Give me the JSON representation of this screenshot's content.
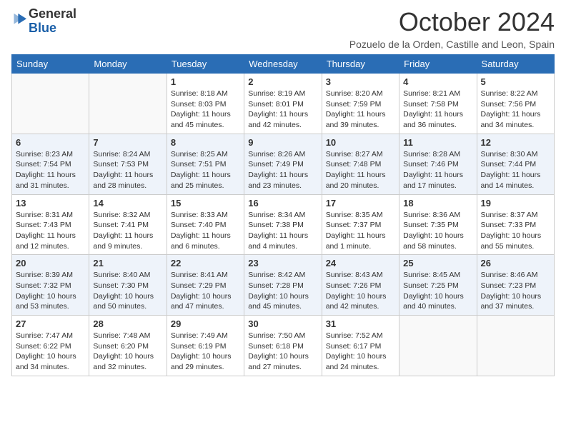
{
  "header": {
    "logo_line1": "General",
    "logo_line2": "Blue",
    "title": "October 2024",
    "location": "Pozuelo de la Orden, Castille and Leon, Spain"
  },
  "days_of_week": [
    "Sunday",
    "Monday",
    "Tuesday",
    "Wednesday",
    "Thursday",
    "Friday",
    "Saturday"
  ],
  "weeks": [
    [
      {
        "day": "",
        "info": ""
      },
      {
        "day": "",
        "info": ""
      },
      {
        "day": "1",
        "info": "Sunrise: 8:18 AM\nSunset: 8:03 PM\nDaylight: 11 hours and 45 minutes."
      },
      {
        "day": "2",
        "info": "Sunrise: 8:19 AM\nSunset: 8:01 PM\nDaylight: 11 hours and 42 minutes."
      },
      {
        "day": "3",
        "info": "Sunrise: 8:20 AM\nSunset: 7:59 PM\nDaylight: 11 hours and 39 minutes."
      },
      {
        "day": "4",
        "info": "Sunrise: 8:21 AM\nSunset: 7:58 PM\nDaylight: 11 hours and 36 minutes."
      },
      {
        "day": "5",
        "info": "Sunrise: 8:22 AM\nSunset: 7:56 PM\nDaylight: 11 hours and 34 minutes."
      }
    ],
    [
      {
        "day": "6",
        "info": "Sunrise: 8:23 AM\nSunset: 7:54 PM\nDaylight: 11 hours and 31 minutes."
      },
      {
        "day": "7",
        "info": "Sunrise: 8:24 AM\nSunset: 7:53 PM\nDaylight: 11 hours and 28 minutes."
      },
      {
        "day": "8",
        "info": "Sunrise: 8:25 AM\nSunset: 7:51 PM\nDaylight: 11 hours and 25 minutes."
      },
      {
        "day": "9",
        "info": "Sunrise: 8:26 AM\nSunset: 7:49 PM\nDaylight: 11 hours and 23 minutes."
      },
      {
        "day": "10",
        "info": "Sunrise: 8:27 AM\nSunset: 7:48 PM\nDaylight: 11 hours and 20 minutes."
      },
      {
        "day": "11",
        "info": "Sunrise: 8:28 AM\nSunset: 7:46 PM\nDaylight: 11 hours and 17 minutes."
      },
      {
        "day": "12",
        "info": "Sunrise: 8:30 AM\nSunset: 7:44 PM\nDaylight: 11 hours and 14 minutes."
      }
    ],
    [
      {
        "day": "13",
        "info": "Sunrise: 8:31 AM\nSunset: 7:43 PM\nDaylight: 11 hours and 12 minutes."
      },
      {
        "day": "14",
        "info": "Sunrise: 8:32 AM\nSunset: 7:41 PM\nDaylight: 11 hours and 9 minutes."
      },
      {
        "day": "15",
        "info": "Sunrise: 8:33 AM\nSunset: 7:40 PM\nDaylight: 11 hours and 6 minutes."
      },
      {
        "day": "16",
        "info": "Sunrise: 8:34 AM\nSunset: 7:38 PM\nDaylight: 11 hours and 4 minutes."
      },
      {
        "day": "17",
        "info": "Sunrise: 8:35 AM\nSunset: 7:37 PM\nDaylight: 11 hours and 1 minute."
      },
      {
        "day": "18",
        "info": "Sunrise: 8:36 AM\nSunset: 7:35 PM\nDaylight: 10 hours and 58 minutes."
      },
      {
        "day": "19",
        "info": "Sunrise: 8:37 AM\nSunset: 7:33 PM\nDaylight: 10 hours and 55 minutes."
      }
    ],
    [
      {
        "day": "20",
        "info": "Sunrise: 8:39 AM\nSunset: 7:32 PM\nDaylight: 10 hours and 53 minutes."
      },
      {
        "day": "21",
        "info": "Sunrise: 8:40 AM\nSunset: 7:30 PM\nDaylight: 10 hours and 50 minutes."
      },
      {
        "day": "22",
        "info": "Sunrise: 8:41 AM\nSunset: 7:29 PM\nDaylight: 10 hours and 47 minutes."
      },
      {
        "day": "23",
        "info": "Sunrise: 8:42 AM\nSunset: 7:28 PM\nDaylight: 10 hours and 45 minutes."
      },
      {
        "day": "24",
        "info": "Sunrise: 8:43 AM\nSunset: 7:26 PM\nDaylight: 10 hours and 42 minutes."
      },
      {
        "day": "25",
        "info": "Sunrise: 8:45 AM\nSunset: 7:25 PM\nDaylight: 10 hours and 40 minutes."
      },
      {
        "day": "26",
        "info": "Sunrise: 8:46 AM\nSunset: 7:23 PM\nDaylight: 10 hours and 37 minutes."
      }
    ],
    [
      {
        "day": "27",
        "info": "Sunrise: 7:47 AM\nSunset: 6:22 PM\nDaylight: 10 hours and 34 minutes."
      },
      {
        "day": "28",
        "info": "Sunrise: 7:48 AM\nSunset: 6:20 PM\nDaylight: 10 hours and 32 minutes."
      },
      {
        "day": "29",
        "info": "Sunrise: 7:49 AM\nSunset: 6:19 PM\nDaylight: 10 hours and 29 minutes."
      },
      {
        "day": "30",
        "info": "Sunrise: 7:50 AM\nSunset: 6:18 PM\nDaylight: 10 hours and 27 minutes."
      },
      {
        "day": "31",
        "info": "Sunrise: 7:52 AM\nSunset: 6:17 PM\nDaylight: 10 hours and 24 minutes."
      },
      {
        "day": "",
        "info": ""
      },
      {
        "day": "",
        "info": ""
      }
    ]
  ]
}
